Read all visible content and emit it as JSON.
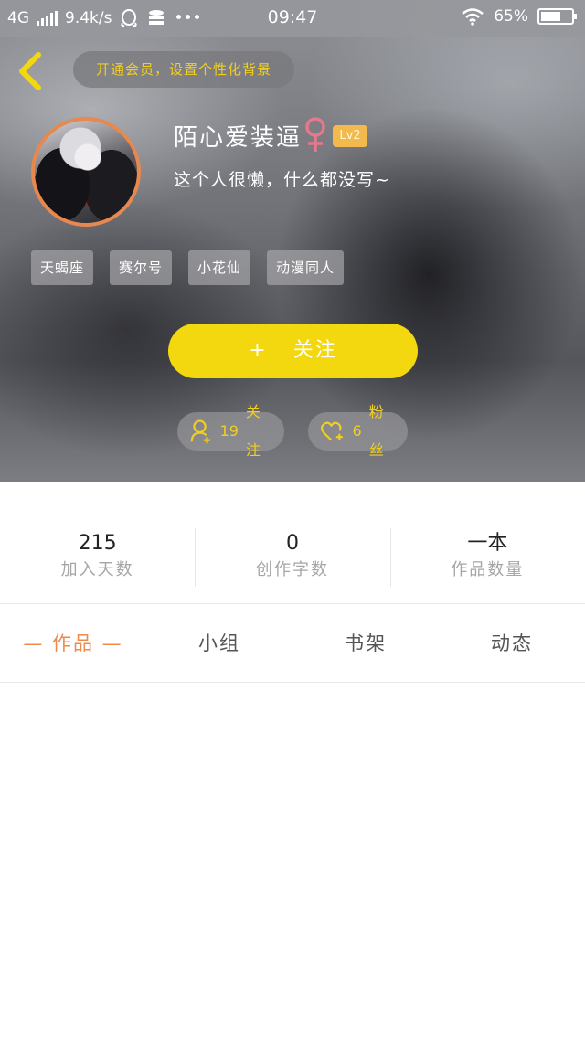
{
  "status_bar": {
    "network": "4G",
    "speed": "9.4k/s",
    "more": "•••",
    "time": "09:47",
    "battery_percent": "65%",
    "battery_level": 0.65
  },
  "top_bar": {
    "vip_banner": "开通会员，设置个性化背景"
  },
  "profile": {
    "username": "陌心爱装逼",
    "level": "Lv2",
    "bio": "这个人很懒，什么都没写~",
    "tags": [
      "天蝎座",
      "赛尔号",
      "小花仙",
      "动漫同人"
    ],
    "follow_button": {
      "plus": "+",
      "label": "关注"
    },
    "following": {
      "count": "19",
      "label": "关注"
    },
    "fans": {
      "count": "6",
      "label": "粉丝"
    }
  },
  "stats": [
    {
      "value": "215",
      "label": "加入天数"
    },
    {
      "value": "0",
      "label": "创作字数"
    },
    {
      "value": "一本",
      "label": "作品数量"
    }
  ],
  "tabs": [
    {
      "label": "— 作品 —",
      "active": true
    },
    {
      "label": "小组",
      "active": false
    },
    {
      "label": "书架",
      "active": false
    },
    {
      "label": "动态",
      "active": false
    }
  ],
  "colors": {
    "accent_yellow": "#f4d80f",
    "tab_active": "#ee8a4e",
    "avatar_border": "#e7884e",
    "gender_icon": "#e7788c",
    "level_badge": "#f2b94d"
  }
}
